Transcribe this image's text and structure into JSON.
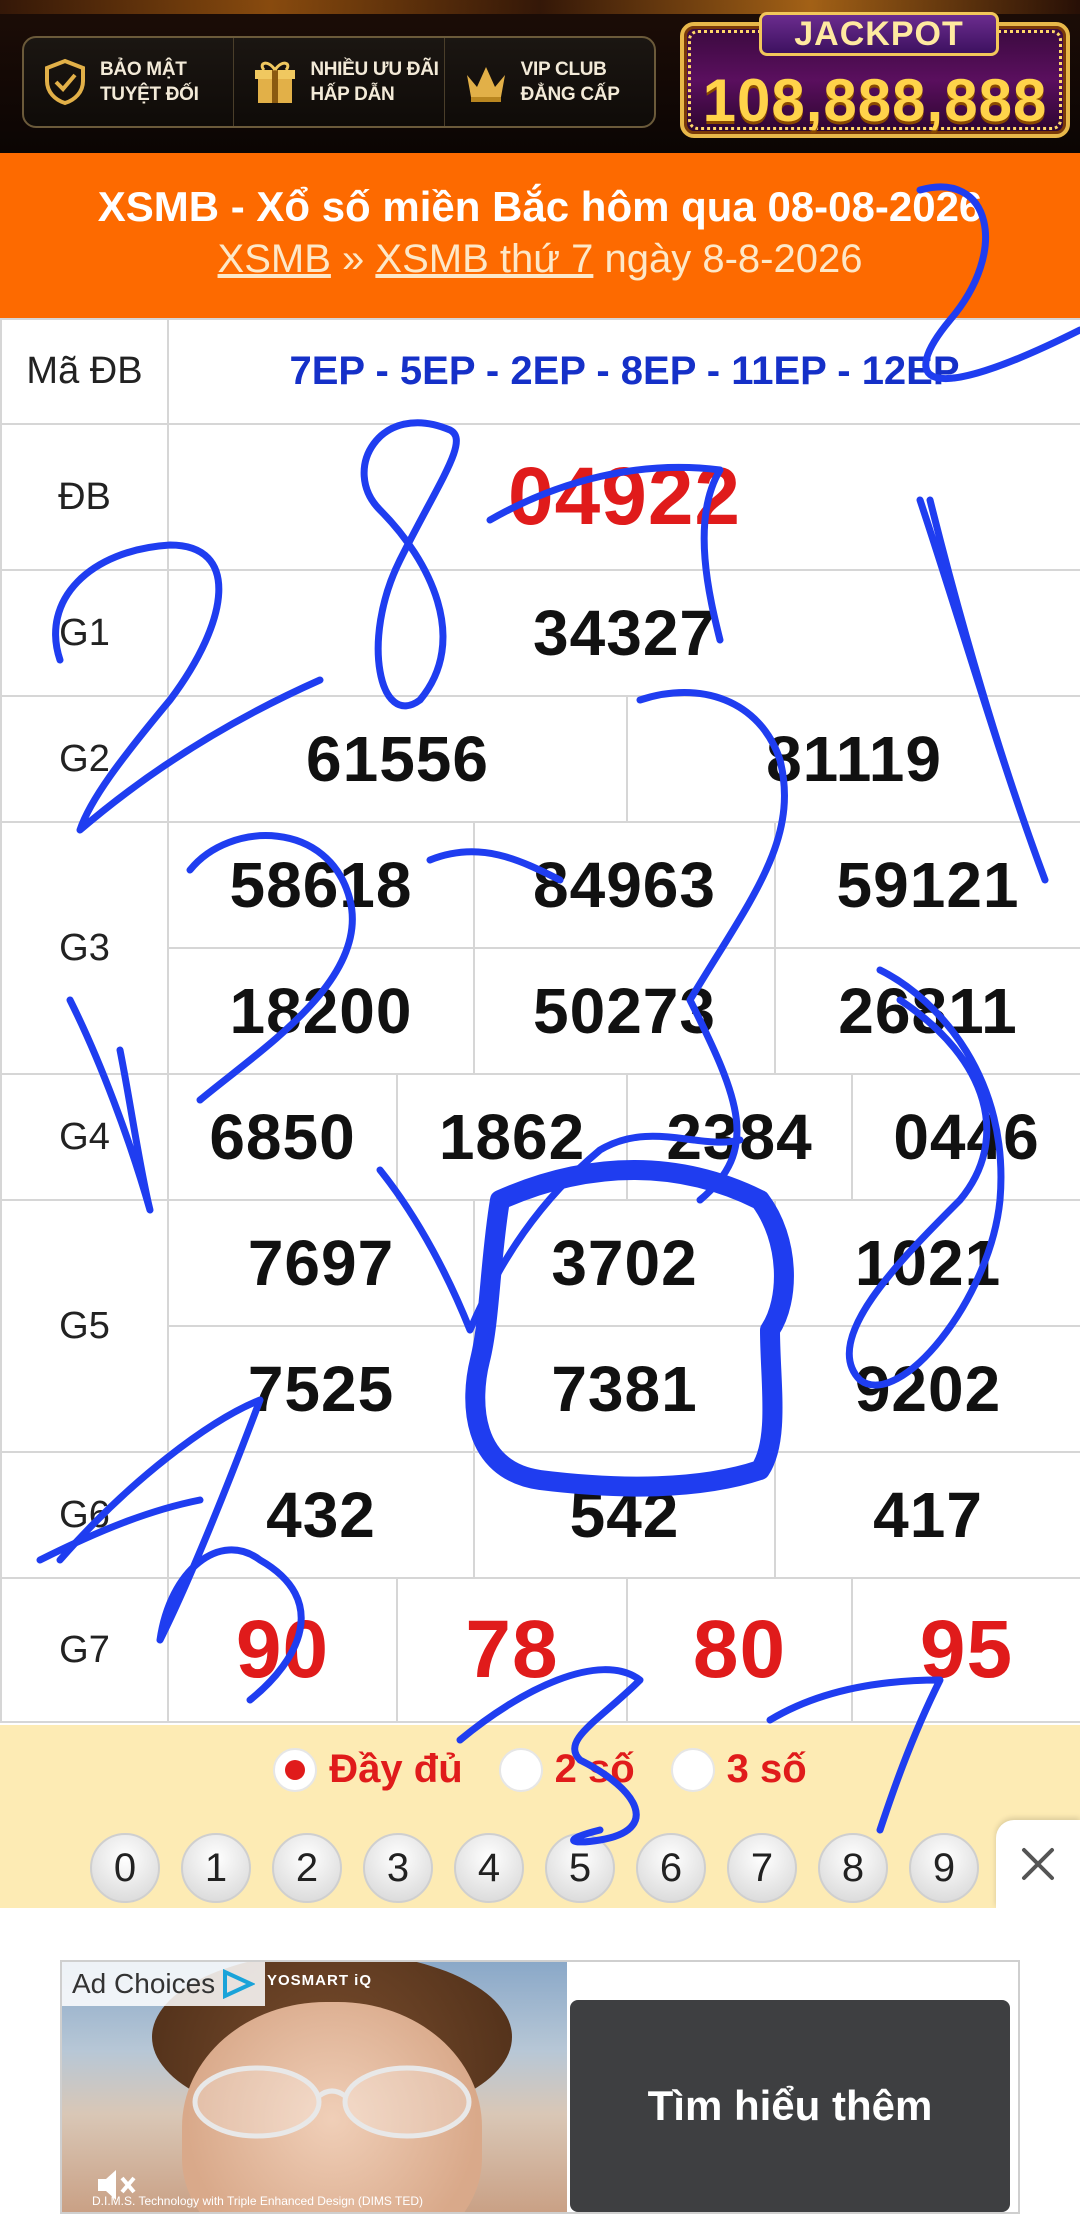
{
  "banner": {
    "perks": [
      {
        "icon": "shield-check-icon",
        "line1": "BẢO MẬT",
        "line2": "TUYỆT ĐỐI"
      },
      {
        "icon": "gift-icon",
        "line1": "NHIỀU ƯU ĐÃI",
        "line2": "HẤP DẪN"
      },
      {
        "icon": "crown-icon",
        "line1": "VIP CLUB",
        "line2": "ĐẲNG CẤP"
      }
    ],
    "jackpot_title": "JACKPOT",
    "jackpot_value": "108,888,888"
  },
  "header": {
    "title": "XSMB - Xổ số miền Bắc hôm qua 08-08-2026",
    "crumb_1": "XSMB",
    "crumb_sep": " » ",
    "crumb_2": "XSMB thứ 7",
    "crumb_tail": " ngày 8-8-2026"
  },
  "results": {
    "code_label": "Mã ĐB",
    "codes": "7EP - 5EP - 2EP - 8EP - 11EP - 12EP",
    "db_label": "ĐB",
    "db": "04922",
    "g1_label": "G1",
    "g1": "34327",
    "g2_label": "G2",
    "g2": [
      "61556",
      "81119"
    ],
    "g3_label": "G3",
    "g3": [
      "58618",
      "84963",
      "59121",
      "18200",
      "50273",
      "26811"
    ],
    "g4_label": "G4",
    "g4": [
      "6850",
      "1862",
      "2384",
      "0446"
    ],
    "g5_label": "G5",
    "g5": [
      "7697",
      "3702",
      "1021",
      "7525",
      "7381",
      "9202"
    ],
    "g6_label": "G6",
    "g6": [
      "432",
      "542",
      "417"
    ],
    "g7_label": "G7",
    "g7": [
      "90",
      "78",
      "80",
      "95"
    ]
  },
  "filter": {
    "options": [
      "Đầy đủ",
      "2 số",
      "3 số"
    ],
    "selected": "Đầy đủ",
    "digits": [
      "0",
      "1",
      "2",
      "3",
      "4",
      "5",
      "6",
      "7",
      "8",
      "9"
    ]
  },
  "ad": {
    "choices_label": "Ad Choices",
    "brand": "YOSMART iQ",
    "caption": "D.I.M.S. Technology with Triple Enhanced Design (DIMS TED)",
    "cta": "Tìm hiểu thêm"
  },
  "colors": {
    "header_bg": "#fd6a00",
    "winner_red": "#e01b1b",
    "code_blue": "#1530c8",
    "filter_bg": "#fdebb4",
    "scribble_blue": "#1f3df0"
  }
}
